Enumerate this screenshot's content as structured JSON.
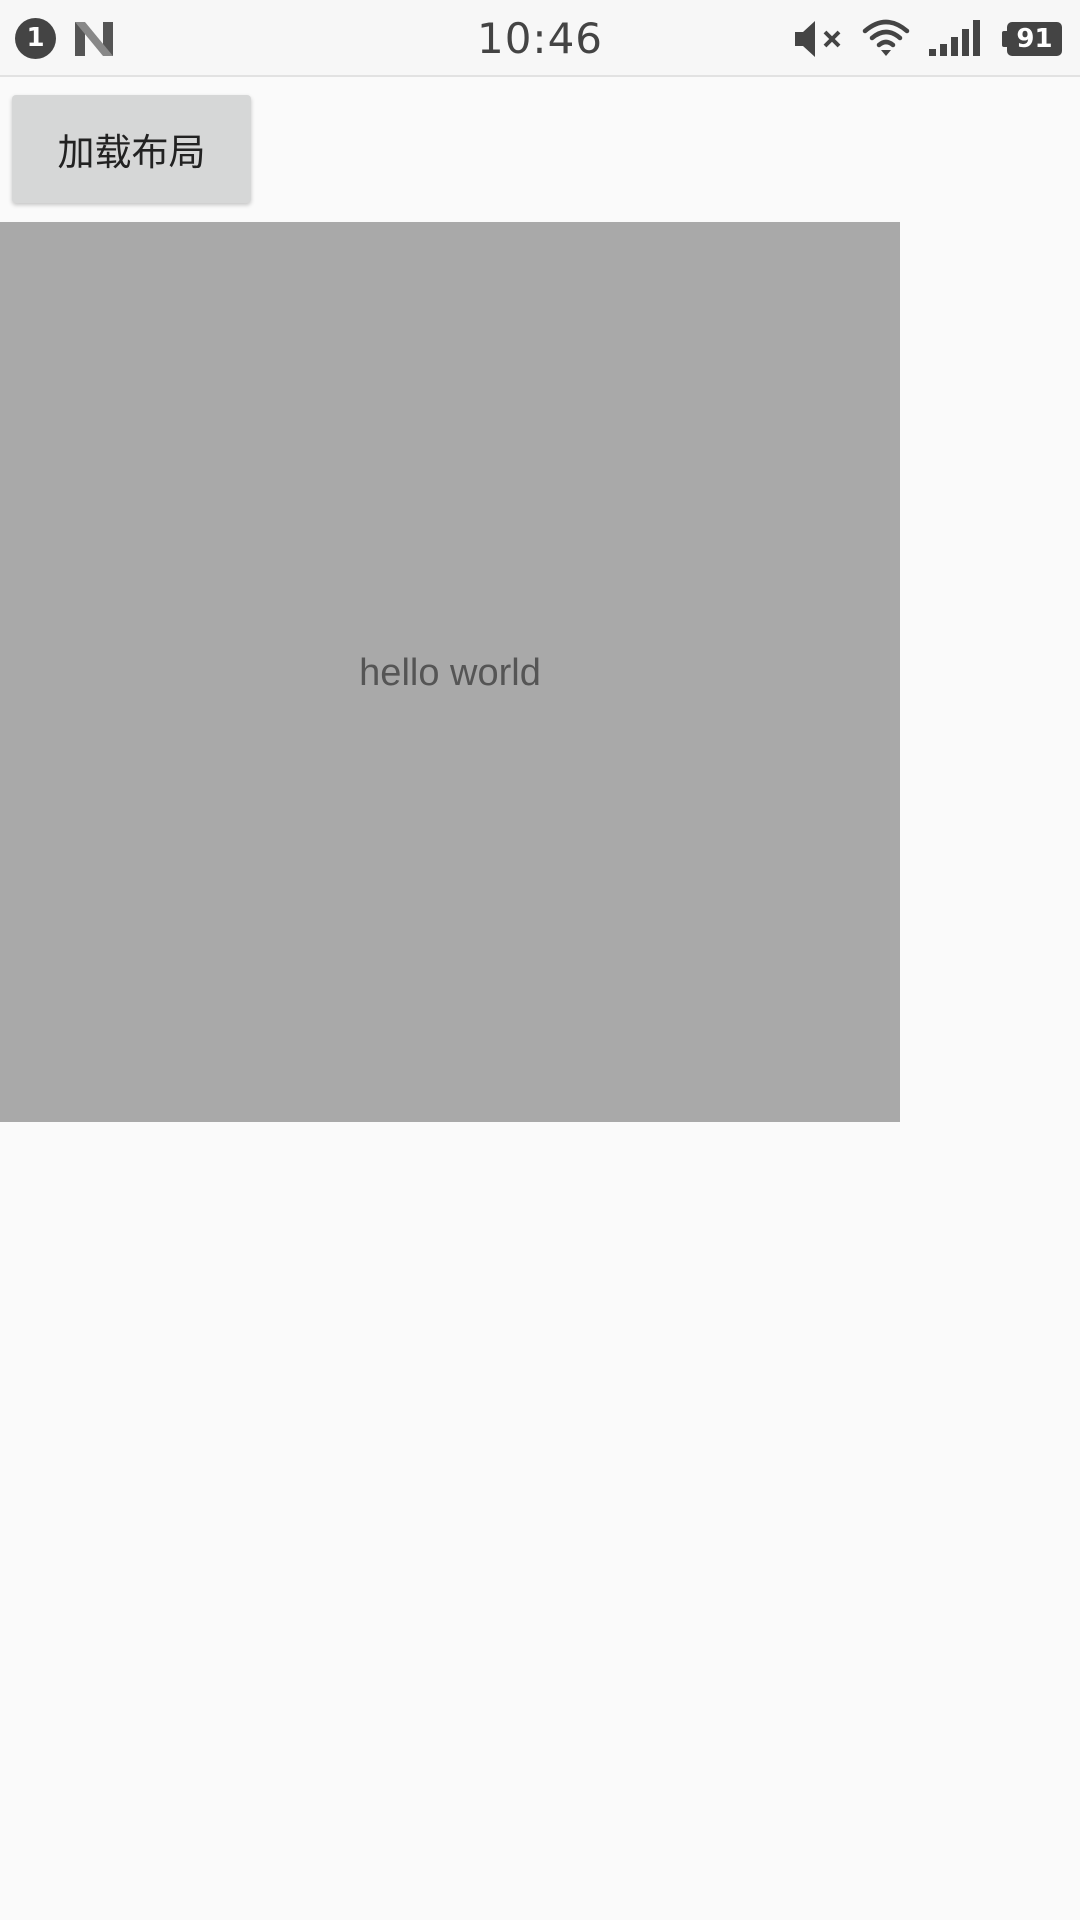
{
  "status_bar": {
    "notification_count": "1",
    "notification_icon": "n-icon",
    "time": "10:46",
    "icons": [
      "mute-icon",
      "wifi-icon",
      "signal-icon"
    ],
    "battery_level": "91",
    "icon_color": "#444444"
  },
  "main": {
    "load_button_label": "加载布局",
    "content_box": {
      "text": "hello world",
      "background": "#a9a9a9"
    }
  },
  "colors": {
    "background": "#fafafa",
    "button_bg": "#d6d7d7"
  }
}
